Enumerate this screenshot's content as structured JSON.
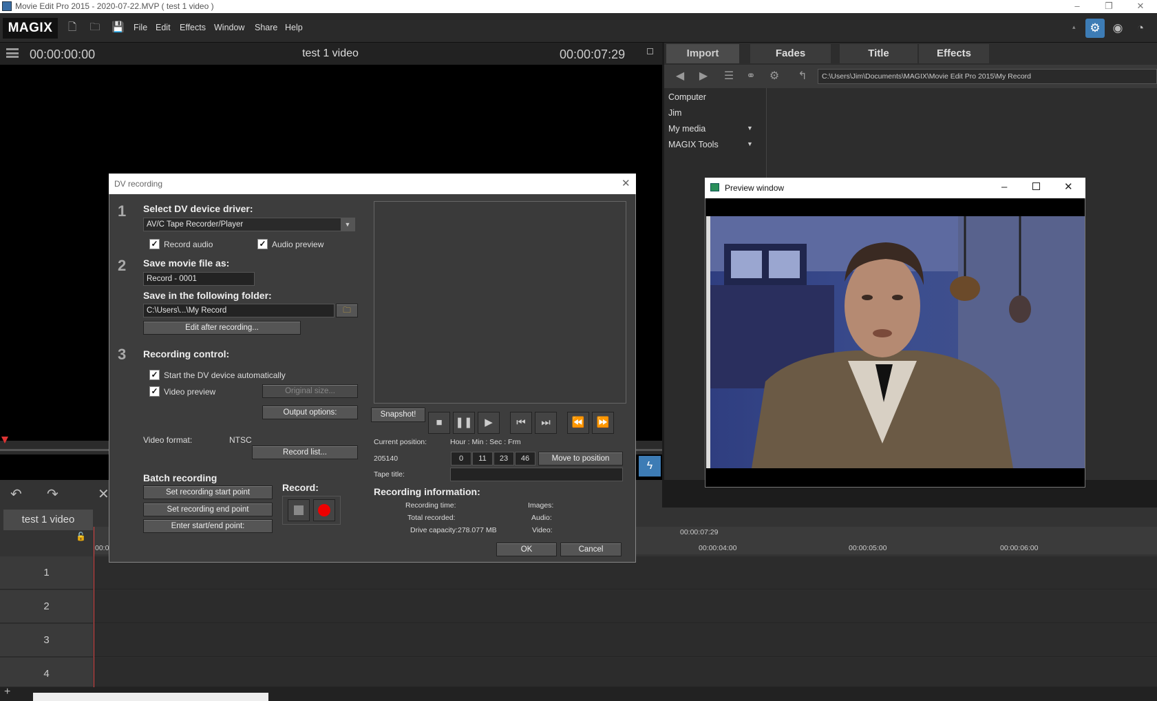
{
  "window": {
    "title": "Movie Edit Pro 2015 - 2020-07-22.MVP ( test 1 video )",
    "controls": [
      "–",
      "❐",
      "✕"
    ]
  },
  "menubar": {
    "logo": "MAGIX",
    "items": [
      "File",
      "Edit",
      "Effects",
      "Window",
      "Share",
      "Help"
    ]
  },
  "player": {
    "timecode_left": "00:00:00:00",
    "title": "test 1 video",
    "timecode_right": "00:00:07:29"
  },
  "right_panel": {
    "tabs": [
      "Import",
      "Fades",
      "Title",
      "Effects"
    ],
    "path": "C:\\Users\\Jim\\Documents\\MAGIX\\Movie Edit Pro 2015\\My Record",
    "tree": [
      "Computer",
      "Jim",
      "My media",
      "MAGIX Tools"
    ]
  },
  "timeline": {
    "title": "test 1 video",
    "ruler_top": "00:00:07:29",
    "ruler_marks": [
      "00:0",
      "00:00:04:00",
      "00:00:05:00",
      "00:00:06:00"
    ],
    "tracks": [
      "1",
      "2",
      "3",
      "4"
    ]
  },
  "dv_dialog": {
    "title": "DV recording",
    "step1": "1",
    "select_driver_label": "Select DV device driver:",
    "driver_value": "AV/C Tape Recorder/Player",
    "record_audio": "Record audio",
    "audio_preview": "Audio preview",
    "step2": "2",
    "save_movie_label": "Save movie file as:",
    "movie_name": "Record - 0001",
    "save_folder_label": "Save in the following folder:",
    "folder_value": "C:\\Users\\...\\My Record",
    "edit_after": "Edit after recording...",
    "step3": "3",
    "recording_control": "Recording control:",
    "start_auto": "Start the DV device automatically",
    "video_preview": "Video preview",
    "original_size": "Original size...",
    "output_options": "Output options:",
    "video_format_label": "Video format:",
    "video_format_value": "NTSC",
    "record_list": "Record list...",
    "batch_recording": "Batch recording",
    "set_start": "Set recording start point",
    "set_end": "Set recording end point",
    "enter_start_end": "Enter start/end point:",
    "record_label": "Record:",
    "snapshot": "Snapshot!",
    "current_position_label": "Current position:",
    "hms_label": "Hour : Min : Sec : Frm",
    "position_value": "205140",
    "pos_h": "0",
    "pos_m": "11",
    "pos_s": "23",
    "pos_f": "46",
    "move_to_position": "Move to position",
    "tape_title_label": "Tape title:",
    "recording_information": "Recording information:",
    "recording_time_label": "Recording time:",
    "total_recorded_label": "Total recorded:",
    "drive_capacity_label": "Drive capacity:",
    "drive_capacity_value": "278.077 MB",
    "images_label": "Images:",
    "audio_label": "Audio:",
    "video_label": "Video:",
    "ok": "OK",
    "cancel": "Cancel"
  },
  "preview_window": {
    "title": "Preview window"
  }
}
